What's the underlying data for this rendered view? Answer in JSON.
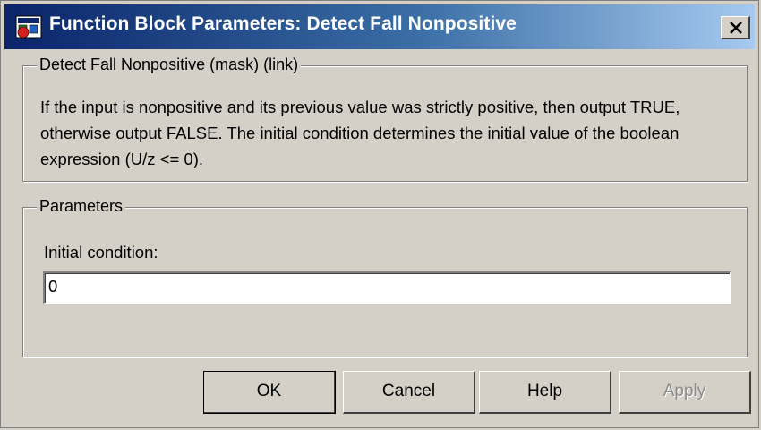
{
  "window": {
    "title": "Function Block Parameters: Detect Fall Nonpositive",
    "icon": "simulink-block-icon",
    "close_icon": "close-icon"
  },
  "description_group": {
    "legend": "Detect Fall Nonpositive (mask) (link)",
    "text": "If the input is nonpositive and its previous value was strictly positive, then output TRUE, otherwise output FALSE.  The initial condition determines the initial value of the boolean expression (U/z <= 0)."
  },
  "parameters_group": {
    "legend": "Parameters",
    "initial_condition_label": "Initial condition:",
    "initial_condition_value": "0"
  },
  "buttons": {
    "ok": "OK",
    "cancel": "Cancel",
    "help": "Help",
    "apply": "Apply"
  }
}
